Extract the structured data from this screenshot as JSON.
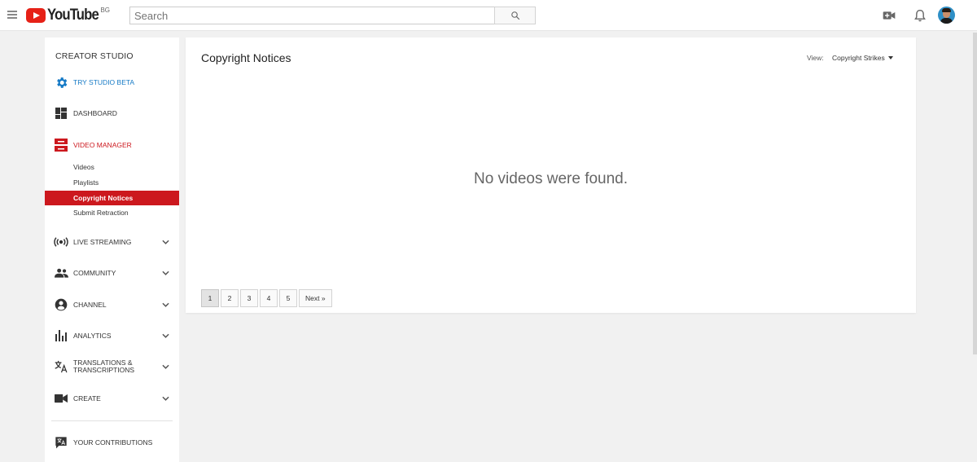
{
  "header": {
    "logo_text": "YouTube",
    "region": "BG",
    "search_placeholder": "Search"
  },
  "sidebar": {
    "heading": "CREATOR STUDIO",
    "try_beta": "TRY STUDIO BETA",
    "dashboard": "DASHBOARD",
    "video_manager": "VIDEO MANAGER",
    "sub_items": [
      "Videos",
      "Playlists",
      "Copyright Notices",
      "Submit Retraction"
    ],
    "live_streaming": "LIVE STREAMING",
    "community": "COMMUNITY",
    "channel": "CHANNEL",
    "analytics": "ANALYTICS",
    "translations_line1": "TRANSLATIONS &",
    "translations_line2": "TRANSCRIPTIONS",
    "create": "CREATE",
    "your_contributions": "YOUR CONTRIBUTIONS"
  },
  "main": {
    "title": "Copyright Notices",
    "view_label": "View:",
    "view_value": "Copyright Strikes",
    "empty_message": "No videos were found.",
    "pages": [
      "1",
      "2",
      "3",
      "4",
      "5"
    ],
    "next_label": "Next »",
    "current_page": 1
  },
  "colors": {
    "accent_red": "#cc181e",
    "beta_blue": "#167ac6",
    "logo_red": "#e62117"
  }
}
